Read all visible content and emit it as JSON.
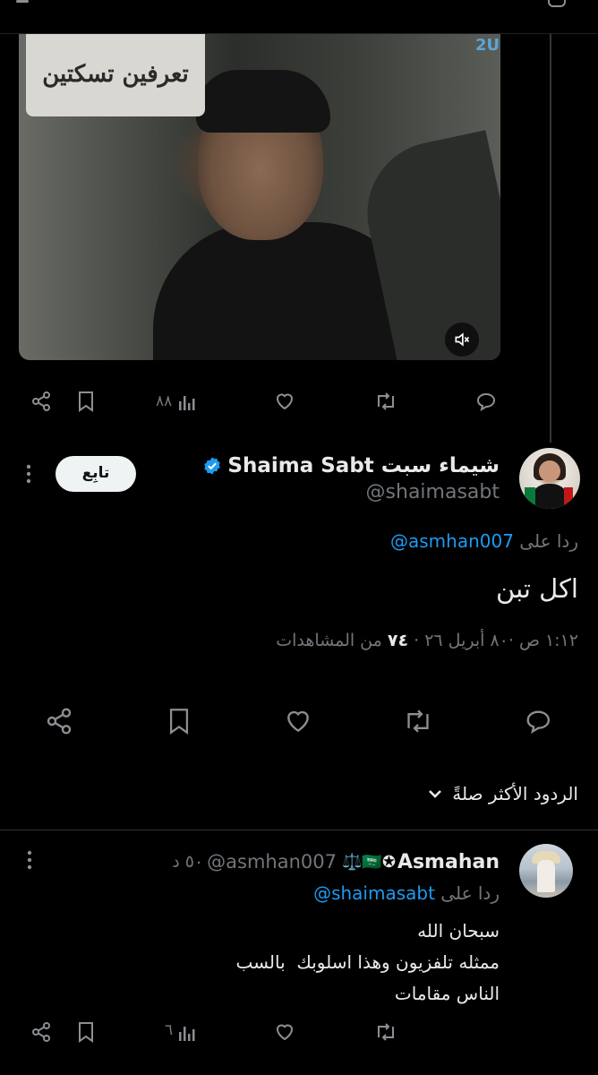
{
  "quoted_post": {
    "media": {
      "overlay_caption": "تعرفين تسكتين",
      "channel_logo": "2U",
      "mute_icon": "speaker-muted-icon"
    },
    "actions": {
      "reply_count": "",
      "views_count": "٨٨"
    }
  },
  "main_post": {
    "author_name": "شيماء سبت Shaima Sabt",
    "handle": "@shaimasabt",
    "follow_label": "تابِع",
    "reply_prefix": "ردا على",
    "reply_to": "@asmhan007",
    "text": "اكل تبن",
    "meta_time": "١:١٢ ص ·٨٠ أبريل ٢٦ ·",
    "meta_views_count": "٧٤",
    "meta_views_label": "من المشاهدات"
  },
  "sort": {
    "label": "الردود الأكثر صلةً"
  },
  "reply": {
    "author_name": "Asmahan",
    "name_emojis": "✪🇸🇦⚖️",
    "handle": "@asmhan007",
    "time": "٥٠ د",
    "reply_prefix": "ردا على",
    "reply_to": "@shaimasabt",
    "lines": [
      "سبحان الله",
      "ممثله تلفزيون وهذا اسلوبك  بالسب",
      "الناس مقامات"
    ],
    "views_count": "٦"
  },
  "colors": {
    "background": "#000000",
    "text": "#e7e9ea",
    "muted": "#71767b",
    "link": "#1d9bf0",
    "divider": "#2f3336"
  }
}
